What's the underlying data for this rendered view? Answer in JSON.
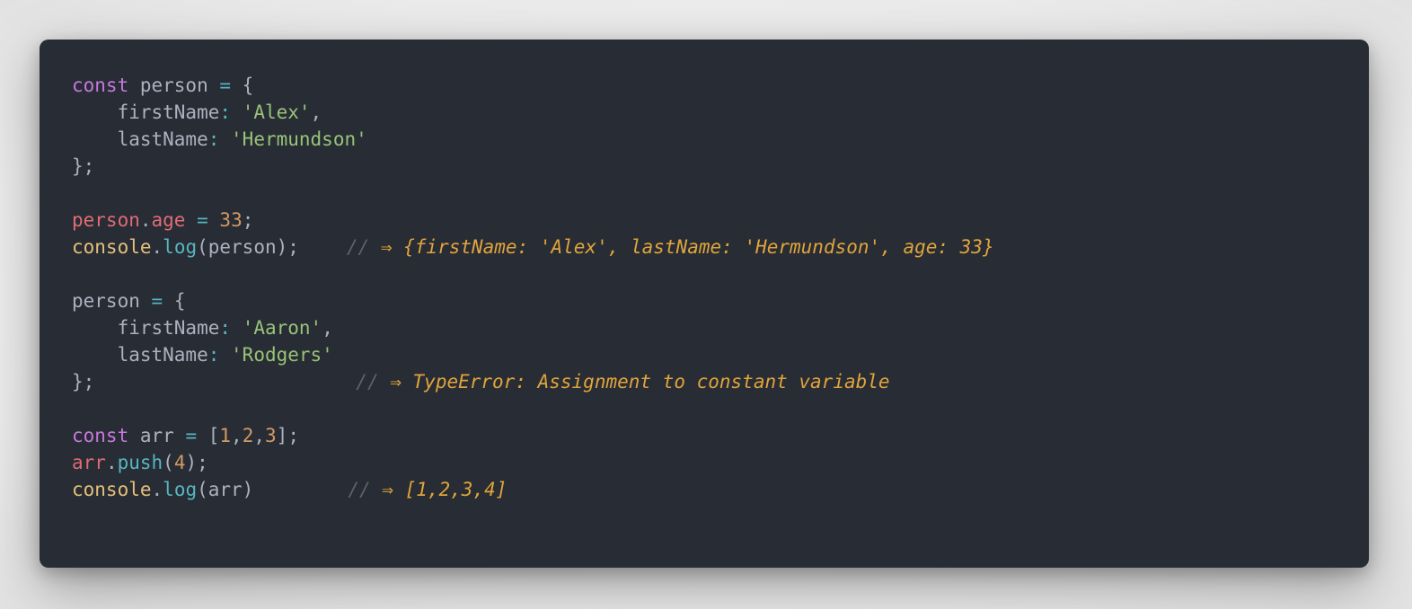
{
  "code": {
    "lines": [
      {
        "tokens": [
          "const",
          " person ",
          "=",
          " {"
        ]
      },
      {
        "tokens": [
          "    firstName",
          ":",
          " ",
          "'Alex'",
          ","
        ]
      },
      {
        "tokens": [
          "    lastName",
          ":",
          " ",
          "'Hermundson'"
        ]
      },
      {
        "tokens": [
          "};"
        ]
      },
      {
        "tokens": []
      },
      {
        "tokens": [
          "person",
          ".",
          "age",
          " ",
          "=",
          " ",
          "33",
          ";"
        ]
      },
      {
        "tokens": [
          "console",
          ".",
          "log",
          "(person);"
        ],
        "comment": "//",
        "result": "⇒ {firstName: 'Alex', lastName: 'Hermundson', age: 33}"
      },
      {
        "tokens": []
      },
      {
        "tokens": [
          "person ",
          "=",
          " {"
        ]
      },
      {
        "tokens": [
          "    firstName",
          ":",
          " ",
          "'Aaron'",
          ","
        ]
      },
      {
        "tokens": [
          "    lastName",
          ":",
          " ",
          "'Rodgers'"
        ]
      },
      {
        "tokens": [
          "};"
        ],
        "comment": "//",
        "result": "⇒ TypeError: Assignment to constant variable"
      },
      {
        "tokens": []
      },
      {
        "tokens": [
          "const",
          " arr ",
          "=",
          " [",
          "1",
          ",",
          "2",
          ",",
          "3",
          "];"
        ]
      },
      {
        "tokens": [
          "arr",
          ".",
          "push",
          "(",
          "4",
          ");"
        ]
      },
      {
        "tokens": [
          "console",
          ".",
          "log",
          "(arr)"
        ],
        "comment": "//",
        "result": "⇒ [1,2,3,4]"
      }
    ]
  },
  "colors": {
    "background": "#282c34",
    "keyword": "#c678dd",
    "string": "#98c379",
    "number": "#d19a66",
    "operator": "#56b6c2",
    "object": "#e06c75",
    "console": "#e5c07b",
    "comment": "#5c6370",
    "result": "#e0a43c"
  }
}
